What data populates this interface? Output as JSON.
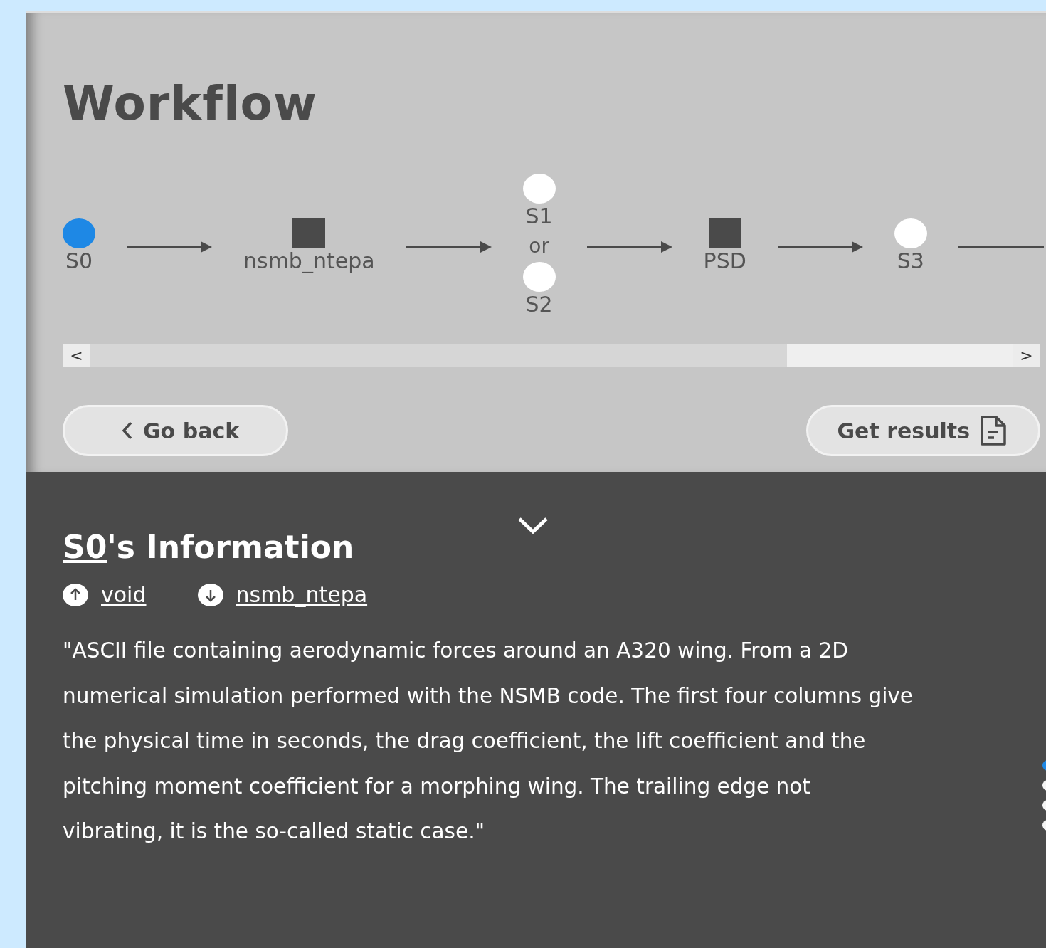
{
  "title": "Workflow",
  "workflow": {
    "nodes": [
      {
        "kind": "state",
        "label": "S0",
        "selected": true
      },
      {
        "kind": "process",
        "label": "nsmb_ntepa"
      },
      {
        "kind": "choice",
        "connector": "or",
        "options": [
          {
            "label": "S1",
            "selected": false
          },
          {
            "label": "S2",
            "selected": false
          }
        ]
      },
      {
        "kind": "process",
        "label": "PSD"
      },
      {
        "kind": "state",
        "label": "S3",
        "selected": false
      }
    ],
    "scroll_left": "<",
    "scroll_right": ">"
  },
  "buttons": [
    {
      "kind": "back",
      "label": "Go back"
    },
    {
      "kind": "results",
      "label": "Get results"
    }
  ],
  "info": {
    "node_link": "S0",
    "title_rest": "'s Information",
    "input": "void",
    "output": "nsmb_ntepa",
    "description": "\"ASCII file containing aerodynamic forces around an A320 wing. From a 2D numerical simulation performed with the NSMB code. The first four columns give the physical time in seconds, the drag coefficient, the lift coefficient and the pitching moment coefficient for a morphing wing. The trailing edge not vibrating, it is the so-called static case.\""
  },
  "pager": [
    {
      "selected": true
    },
    {
      "selected": false
    },
    {
      "selected": false
    },
    {
      "selected": false
    }
  ]
}
